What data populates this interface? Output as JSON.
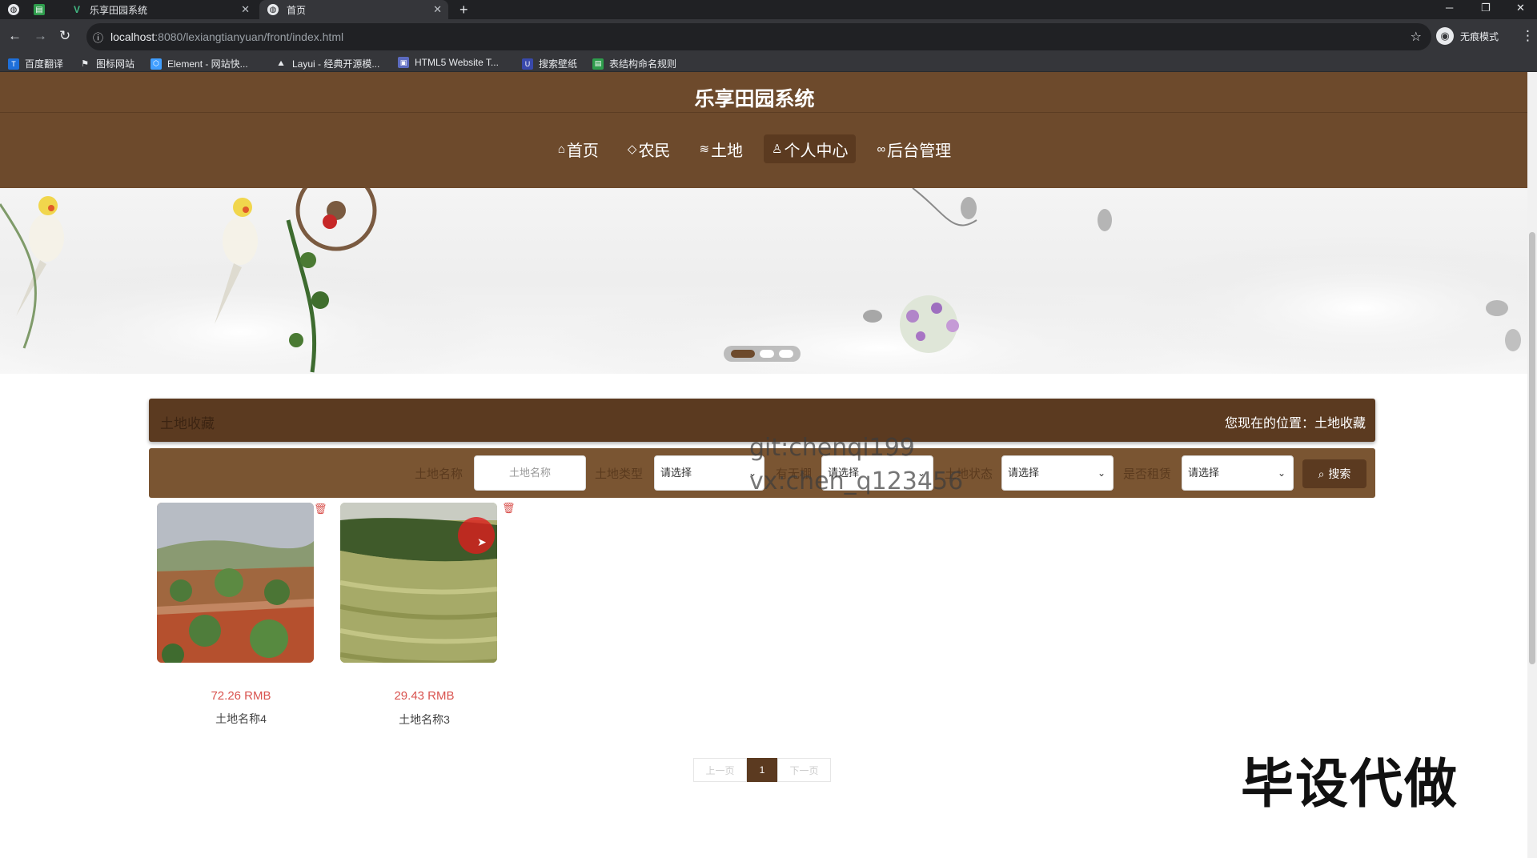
{
  "browser": {
    "tabs": [
      {
        "label": ""
      },
      {
        "label": "乐享田园系统"
      },
      {
        "label": "首页"
      }
    ],
    "url_host": "localhost",
    "url_path": ":8080/lexiangtianyuan/front/index.html",
    "profile_label": "无痕模式",
    "bookmarks": [
      {
        "label": "百度翻译",
        "color": "#1e6fd9"
      },
      {
        "label": "图标网站",
        "color": "#333333"
      },
      {
        "label": "Element - 网站快...",
        "color": "#409eff"
      },
      {
        "label": "Layui - 经典开源模...",
        "color": "#555555"
      },
      {
        "label": "HTML5 Website T...",
        "color": "#5c6bc0"
      },
      {
        "label": "搜索壁纸",
        "color": "#3949ab"
      },
      {
        "label": "表结构命名规则",
        "color": "#2e9d4c"
      }
    ]
  },
  "site": {
    "title": "乐享田园系统",
    "nav": [
      {
        "label": "首页",
        "icon": "home-icon",
        "glyph": "⌂"
      },
      {
        "label": "农民",
        "icon": "tag-icon",
        "glyph": "◇"
      },
      {
        "label": "土地",
        "icon": "layers-icon",
        "glyph": "≋"
      },
      {
        "label": "个人中心",
        "icon": "user-icon",
        "glyph": "♙"
      },
      {
        "label": "后台管理",
        "icon": "link-icon",
        "glyph": "∞"
      }
    ],
    "active_nav": "个人中心"
  },
  "banner": {
    "slides": 3,
    "active_slide": 1
  },
  "breadcrumb": {
    "title": "土地收藏",
    "position": "您现在的位置：土地收藏"
  },
  "filters": {
    "name_label": "土地名称",
    "name_placeholder": "土地名称",
    "type_label": "土地类型",
    "type_value": "请选择",
    "area_label": "有无棚",
    "area_value": "请选择",
    "status_label": "土地状态",
    "status_value": "请选择",
    "rent_label": "是否租赁",
    "rent_value": "请选择",
    "search_label": "搜索"
  },
  "watermarks": {
    "line1": "git:chenqi199",
    "line2": "vx:chen_q123456"
  },
  "items": [
    {
      "price": "72.26 RMB",
      "name": "土地名称4"
    },
    {
      "price": "29.43 RMB",
      "name": "土地名称3"
    }
  ],
  "pagination": {
    "prev": "上一页",
    "current": "1",
    "next": "下一页"
  },
  "promo_text": "毕设代做",
  "colors": {
    "brand": "#6d4a2c",
    "brand_dark": "#5b3a20",
    "price": "#d9534f"
  }
}
